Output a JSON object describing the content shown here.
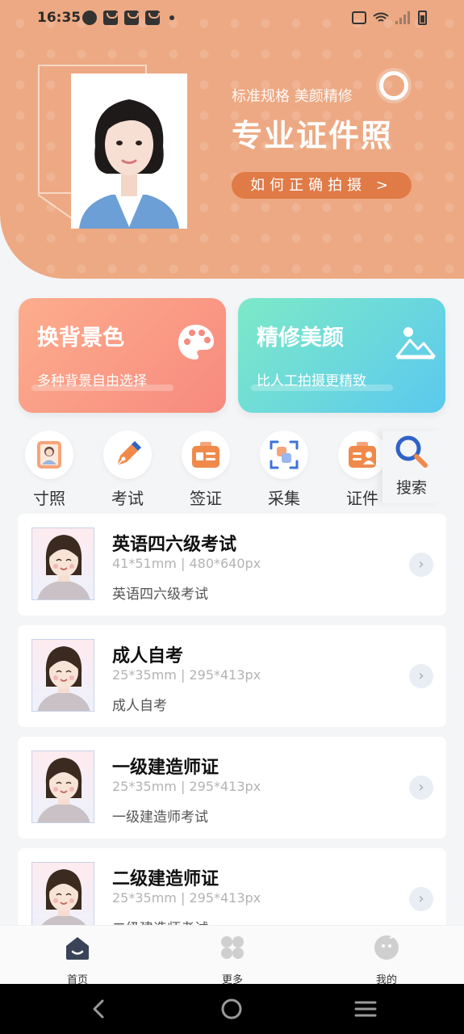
{
  "status_bar": {
    "time": "16:35"
  },
  "hero": {
    "subtitle": "标准规格 美颜精修",
    "title": "专业证件照",
    "button_label": "如何正确拍摄 >"
  },
  "features": [
    {
      "title": "换背景色",
      "subtitle": "多种背景自由选择"
    },
    {
      "title": "精修美颜",
      "subtitle": "比人工拍摄更精致"
    }
  ],
  "categories": [
    {
      "label": "寸照",
      "icon": "portrait-icon"
    },
    {
      "label": "考试",
      "icon": "pen-icon"
    },
    {
      "label": "签证",
      "icon": "visa-icon"
    },
    {
      "label": "采集",
      "icon": "scan-icon"
    },
    {
      "label": "证件",
      "icon": "id-card-icon"
    }
  ],
  "search": {
    "label": "搜索",
    "icon": "search-icon"
  },
  "items": [
    {
      "title": "英语四六级考试",
      "spec": "41*51mm | 480*640px",
      "desc": "英语四六级考试"
    },
    {
      "title": "成人自考",
      "spec": "25*35mm | 295*413px",
      "desc": "成人自考"
    },
    {
      "title": "一级建造师证",
      "spec": "25*35mm | 295*413px",
      "desc": "一级建造师考试"
    },
    {
      "title": "二级建造师证",
      "spec": "25*35mm | 295*413px",
      "desc": "二级建造师考试"
    }
  ],
  "bottom_nav": [
    {
      "label": "首页",
      "icon": "home-icon",
      "active": true
    },
    {
      "label": "更多",
      "icon": "grid-icon",
      "active": false
    },
    {
      "label": "我的",
      "icon": "profile-icon",
      "active": false
    }
  ],
  "colors": {
    "hero_bg": "#eda983",
    "hero_button": "#e07a47",
    "accent_blue": "#2f63c9",
    "nav_active": "#3a4458"
  }
}
